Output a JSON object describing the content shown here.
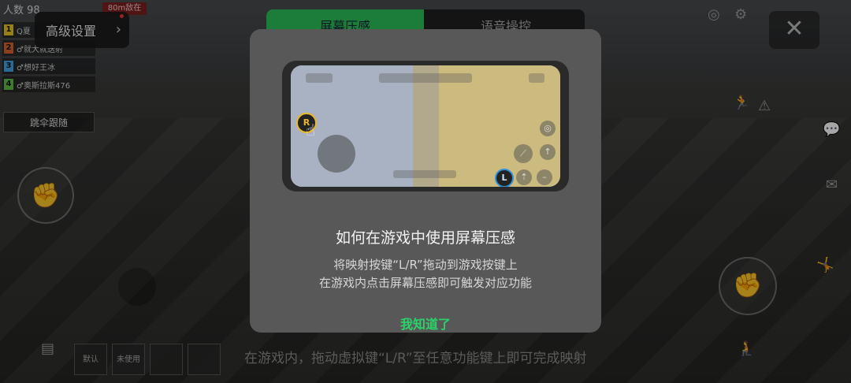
{
  "hud": {
    "players_label": "人数 98",
    "badge": "80m敌在",
    "team": [
      {
        "num": "1",
        "name": "Q夏",
        "color": "#e8c326"
      },
      {
        "num": "2",
        "name": "♂就大就送射",
        "color": "#d9622b"
      },
      {
        "num": "3",
        "name": "♂想好王冰",
        "color": "#3fa3e8"
      },
      {
        "num": "4",
        "name": "♂奥斯拉斯476",
        "color": "#5bbf47"
      }
    ],
    "follow_label": "跳伞跟随"
  },
  "advanced_settings": {
    "label": "高级设置",
    "chevron": "›"
  },
  "close_label": "✕",
  "tabs": {
    "active": "屏幕压感",
    "inactive": "语音操控"
  },
  "bottom": {
    "slots": [
      "默认",
      "未使用",
      "",
      ""
    ],
    "hint": "在游戏内，拖动虚拟键“L/R”至任意功能键上即可完成映射"
  },
  "modal": {
    "r_marker": "R",
    "l_marker": "L",
    "title": "如何在游戏中使用屏幕压感",
    "desc_line1": "将映射按键“L/R”拖动到游戏按键上",
    "desc_line2": "在游戏内点击屏幕压感即可触发对应功能",
    "ok_label": "我知道了"
  },
  "colors": {
    "accent": "#2bc15a",
    "r_ring": "#e9b824",
    "l_ring": "#2f8fe0"
  }
}
